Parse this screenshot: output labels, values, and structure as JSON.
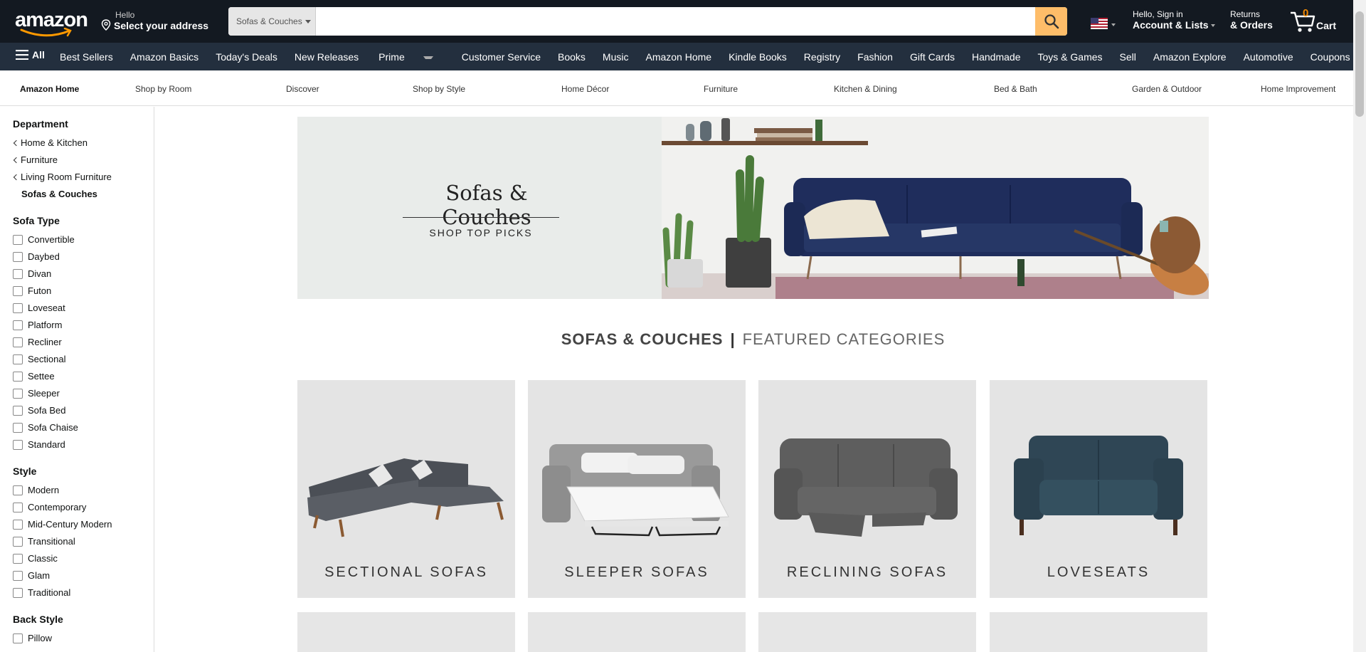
{
  "header": {
    "logo_text": "amazon",
    "address_line1": "Hello",
    "address_line2": "Select your address",
    "search_category": "Sofas & Couches",
    "search_placeholder": "",
    "account_line1": "Hello, Sign in",
    "account_line2": "Account & Lists",
    "returns_line1": "Returns",
    "returns_line2": "& Orders",
    "cart_count": "0",
    "cart_label": "Cart",
    "accent_color": "#febd69",
    "bg_color": "#131921"
  },
  "nav": {
    "all_label": "All",
    "items": [
      "Best Sellers",
      "Amazon Basics",
      "Today's Deals",
      "New Releases",
      "Prime",
      "Customer Service",
      "Books",
      "Music",
      "Amazon Home",
      "Kindle Books",
      "Registry",
      "Fashion",
      "Gift Cards",
      "Handmade",
      "Toys & Games",
      "Sell",
      "Amazon Explore",
      "Automotive",
      "Coupons"
    ]
  },
  "subnav": {
    "items": [
      "Amazon Home",
      "Shop by Room",
      "Discover",
      "Shop by Style",
      "Home Décor",
      "Furniture",
      "Kitchen & Dining",
      "Bed & Bath",
      "Garden & Outdoor",
      "Home Improvement"
    ]
  },
  "sidebar": {
    "department_heading": "Department",
    "breadcrumbs": [
      "Home & Kitchen",
      "Furniture",
      "Living Room Furniture"
    ],
    "current": "Sofas & Couches",
    "sofa_type_heading": "Sofa Type",
    "sofa_types": [
      "Convertible",
      "Daybed",
      "Divan",
      "Futon",
      "Loveseat",
      "Platform",
      "Recliner",
      "Sectional",
      "Settee",
      "Sleeper",
      "Sofa Bed",
      "Sofa Chaise",
      "Standard"
    ],
    "style_heading": "Style",
    "styles": [
      "Modern",
      "Contemporary",
      "Mid-Century Modern",
      "Transitional",
      "Classic",
      "Glam",
      "Traditional"
    ],
    "back_style_heading": "Back Style",
    "back_styles": [
      "Pillow"
    ]
  },
  "hero": {
    "title": "Sofas & Couches",
    "subtitle": "SHOP TOP PICKS"
  },
  "featured": {
    "title_strong": "SOFAS & COUCHES",
    "separator": "|",
    "title_light": "FEATURED CATEGORIES",
    "tiles": [
      "SECTIONAL SOFAS",
      "SLEEPER SOFAS",
      "RECLINING SOFAS",
      "LOVESEATS"
    ]
  }
}
